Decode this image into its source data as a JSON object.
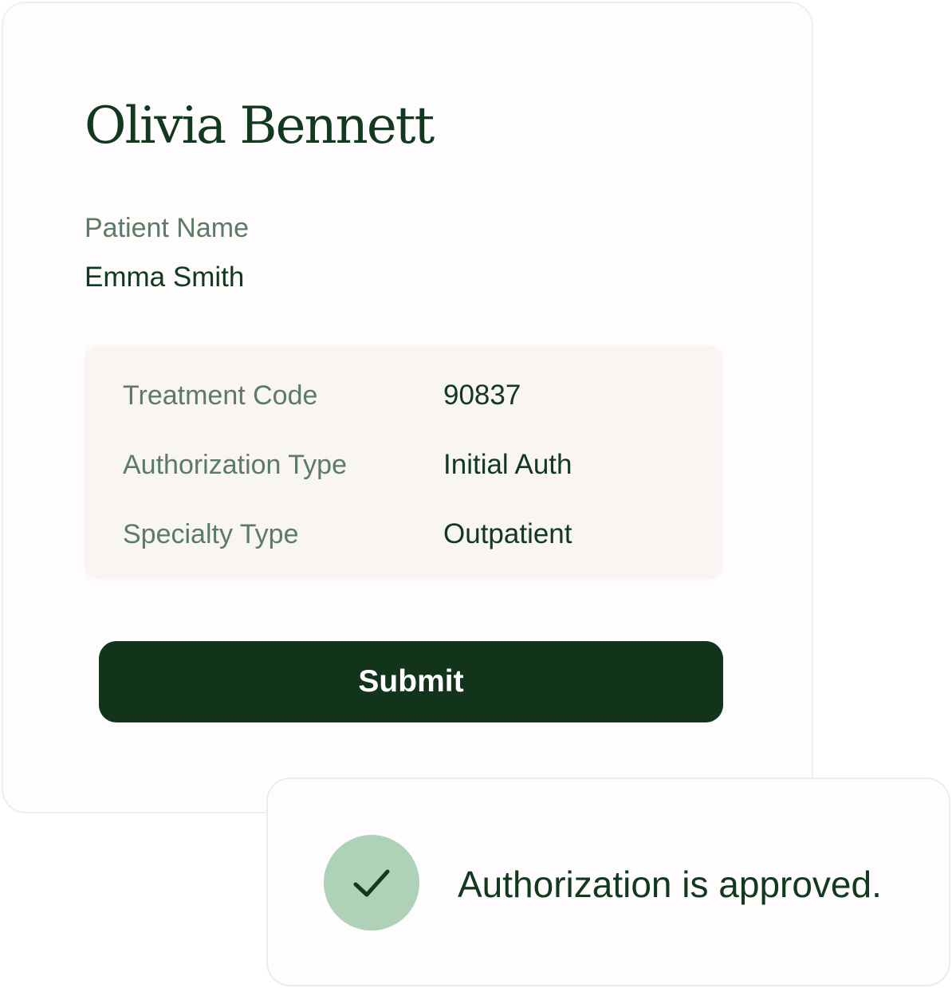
{
  "form": {
    "title": "Olivia Bennett",
    "patient_name_label": "Patient Name",
    "patient_name_value": "Emma Smith",
    "details": [
      {
        "label": "Treatment Code",
        "value": "90837"
      },
      {
        "label": "Authorization Type",
        "value": "Initial Auth"
      },
      {
        "label": "Specialty Type",
        "value": "Outpatient"
      }
    ],
    "submit_label": "Submit"
  },
  "toast": {
    "icon": "check-icon",
    "message": "Authorization is approved."
  },
  "colors": {
    "primary_dark_green": "#11341b",
    "text_green": "#12381f",
    "label_green": "#5d7a66",
    "success_circle": "#aed1b8",
    "details_background": "#f8f5f2"
  }
}
